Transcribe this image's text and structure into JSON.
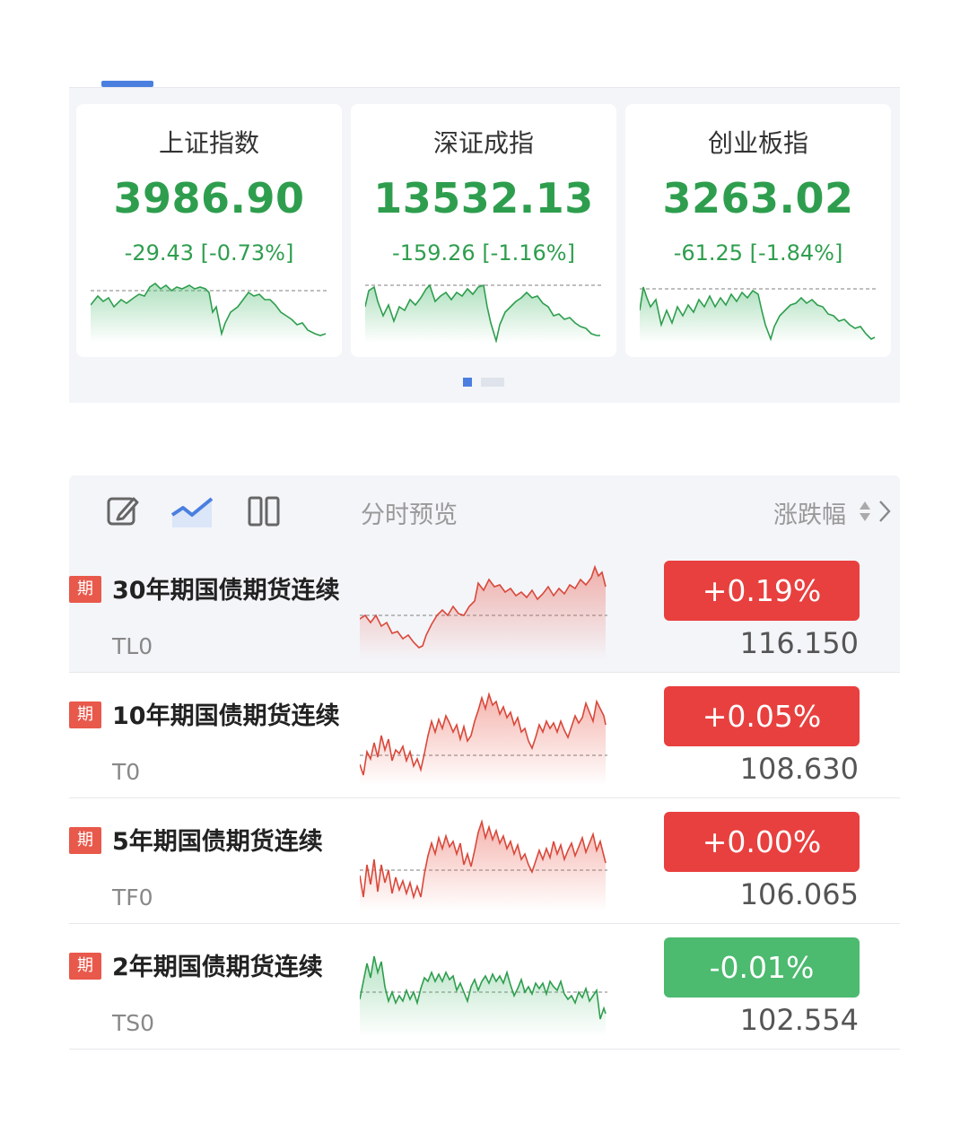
{
  "indices": [
    {
      "name": "上证指数",
      "value": "3986.90",
      "change": "-29.43 [-0.73%]"
    },
    {
      "name": "深证成指",
      "value": "13532.13",
      "change": "-159.26 [-1.16%]"
    },
    {
      "name": "创业板指",
      "value": "3263.02",
      "change": "-61.25 [-1.84%]"
    }
  ],
  "carousel": {
    "pages": 2,
    "active_page": 1
  },
  "list": {
    "header": {
      "title": "分时预览",
      "sort_label": "涨跌幅",
      "edit_icon": "edit-icon",
      "chart_icon": "trend-line-icon",
      "layout_icon": "two-column-icon"
    },
    "rows": [
      {
        "badge": "期",
        "name": "30年期国债期货连续",
        "code": "TL0",
        "change": "+0.19%",
        "price": "116.150",
        "direction": "up",
        "highlight": true
      },
      {
        "badge": "期",
        "name": "10年期国债期货连续",
        "code": "T0",
        "change": "+0.05%",
        "price": "108.630",
        "direction": "up",
        "highlight": false
      },
      {
        "badge": "期",
        "name": "5年期国债期货连续",
        "code": "TF0",
        "change": "+0.00%",
        "price": "106.065",
        "direction": "up",
        "highlight": false
      },
      {
        "badge": "期",
        "name": "2年期国债期货连续",
        "code": "TS0",
        "change": "-0.01%",
        "price": "102.554",
        "direction": "down",
        "highlight": false
      }
    ]
  },
  "colors": {
    "up": "#e8403f",
    "down": "#4cba6f",
    "index_green": "#2e9e4e",
    "accent": "#4a7fe0"
  }
}
